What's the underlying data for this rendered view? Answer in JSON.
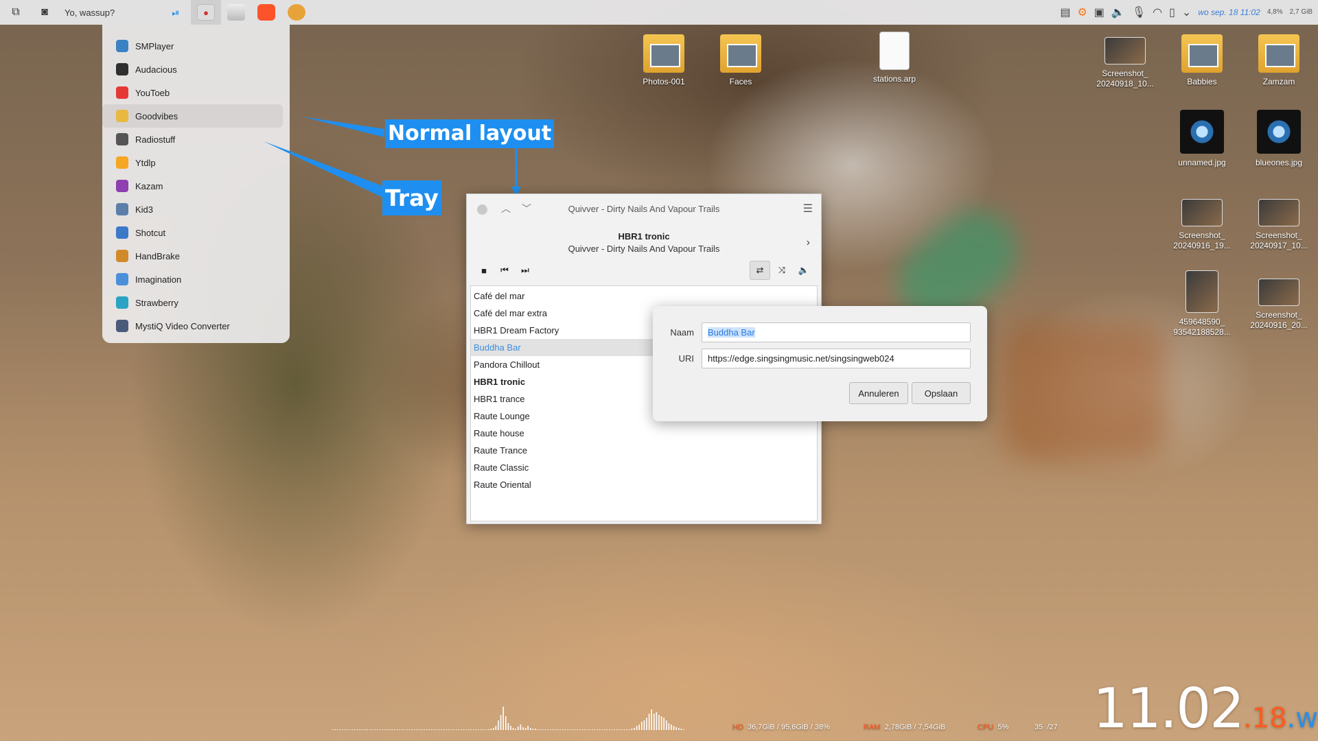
{
  "topbar": {
    "title": "Yo, wassup?",
    "apps": [
      "play-pause",
      "record",
      "file-manager",
      "brave-browser",
      "audio-app"
    ],
    "date": "wo sep. 18 11:02",
    "stat_cpu": "4,8%",
    "stat_mem": "2,7 GiB"
  },
  "app_menu": {
    "items": [
      {
        "label": "SMPlayer",
        "color": "#3b82c4"
      },
      {
        "label": "Audacious",
        "color": "#2f2f2f"
      },
      {
        "label": "YouToeb",
        "color": "#e53935"
      },
      {
        "label": "Goodvibes",
        "color": "#e8b840"
      },
      {
        "label": "Radiostuff",
        "color": "#555555"
      },
      {
        "label": "Ytdlp",
        "color": "#f5a623"
      },
      {
        "label": "Kazam",
        "color": "#8e3fb0"
      },
      {
        "label": "Kid3",
        "color": "#5a7fa8"
      },
      {
        "label": "Shotcut",
        "color": "#3c78c8"
      },
      {
        "label": "HandBrake",
        "color": "#d08a2a"
      },
      {
        "label": "Imagination",
        "color": "#4a90d9"
      },
      {
        "label": "Strawberry",
        "color": "#2aa3c4"
      },
      {
        "label": "MystiQ Video Converter",
        "color": "#4a5a7a"
      }
    ]
  },
  "annotations": {
    "normal_layout": "Normal layout",
    "tray": "Tray"
  },
  "desktop_icons": {
    "photos": "Photos-001",
    "faces": "Faces",
    "stations": "stations.arp",
    "screenshot1": "Screenshot_\n20240918_10...",
    "babbies": "Babbies",
    "zamzam": "Zamzam",
    "unnamed": "unnamed.jpg",
    "blueones": "blueones.jpg",
    "screenshot2": "Screenshot_\n20240916_19...",
    "screenshot3": "Screenshot_\n20240917_10...",
    "photo459": "459648590_\n93542188528...",
    "screenshot4": "Screenshot_\n20240916_20..."
  },
  "player": {
    "window_title": "Quivver - Dirty Nails And Vapour Trails",
    "station": "HBR1 tronic",
    "track": "Quivver - Dirty Nails And Vapour Trails",
    "stations": [
      "Café del mar",
      "Café del mar extra",
      "HBR1 Dream Factory",
      "Buddha Bar",
      "Pandora Chillout",
      "HBR1 tronic",
      "HBR1 trance",
      "Raute Lounge",
      "Raute house",
      "Raute Trance",
      "Raute Classic",
      "Raute Oriental"
    ],
    "selected": "Buddha Bar",
    "playing": "HBR1 tronic"
  },
  "dialog": {
    "name_label": "Naam",
    "name_value": "Buddha Bar",
    "uri_label": "URI",
    "uri_value": "https://edge.singsingmusic.net/singsingweb024",
    "cancel": "Annuleren",
    "save": "Opslaan"
  },
  "sysinfo": {
    "hd_label": "HD",
    "hd_value": "36,7GiB / 95,6GiB / 38%",
    "ram_label": "RAM",
    "ram_value": "2,78GiB / 7,54GiB",
    "cpu_label": "CPU",
    "cpu_value": "5%",
    "temp_value": "35",
    "temp_extra": "/27"
  },
  "clock": {
    "time": "11.02",
    "day": ".18",
    "weekday": ".wo"
  }
}
